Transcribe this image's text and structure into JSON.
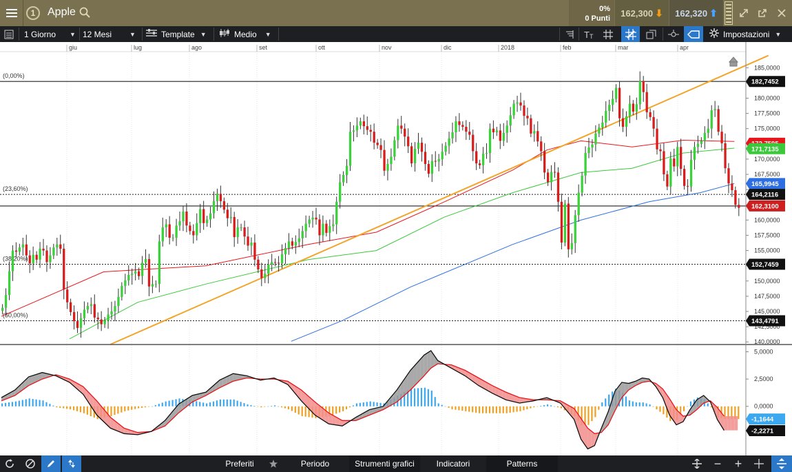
{
  "header": {
    "title": "Apple",
    "change_pct": "0%",
    "change_points": "0 Punti",
    "sell_price": "162,300",
    "buy_price": "162,320",
    "colors": {
      "bar": "#7a7150",
      "sell_arrow": "#f39c12",
      "buy_arrow": "#4aa3ff"
    }
  },
  "toolbar": {
    "interval": "1 Giorno",
    "range": "12 Mesi",
    "template": "Template",
    "style": "Medio",
    "settings": "Impostazioni",
    "icons": [
      "list-icon",
      "bar-icon",
      "text-tool-icon",
      "grid-icon",
      "crosshair-grid-icon",
      "copy-icon",
      "magnet-icon",
      "shape-icon",
      "settings-gear-icon"
    ]
  },
  "chart_data": [
    {
      "type": "candlestick",
      "instrument": "Apple",
      "x_labels": [
        "giu",
        "lug",
        "ago",
        "set",
        "ott",
        "nov",
        "dic",
        "2018",
        "feb",
        "mar",
        "apr"
      ],
      "y_ticks": [
        "185,0000",
        "182,5000",
        "180,0000",
        "177,5000",
        "175,0000",
        "172,5000",
        "170,0000",
        "167,5000",
        "165,0000",
        "162,5000",
        "160,0000",
        "157,5000",
        "155,0000",
        "152,5000",
        "150,0000",
        "147,5000",
        "145,0000",
        "142,5000",
        "140,0000"
      ],
      "ylim": [
        139.8,
        186.5
      ],
      "fib_levels": [
        {
          "label": "(0,00%)",
          "value": 182.7452,
          "tag": "182,7452"
        },
        {
          "label": "(23,60%)",
          "value": 164.2116,
          "tag": "164,2116"
        },
        {
          "label": "(38,20%)",
          "value": 152.7459,
          "tag": "152,7459"
        },
        {
          "label": "(50,00%)",
          "value": 143.4791,
          "tag": "143,4791"
        }
      ],
      "price_line": {
        "value": 162.31,
        "tag": "162,3100",
        "color": "#cc1f1f"
      },
      "ma_tags": [
        {
          "value": 172.6,
          "tag": "172,7595",
          "color": "#e8161b"
        },
        {
          "value": 171.71,
          "tag": "171,7135",
          "color": "#3bc93b"
        },
        {
          "value": 165.99,
          "tag": "165,9945",
          "color": "#2d6fe0"
        }
      ],
      "close": [
        145.6,
        147.7,
        151.6,
        155.0,
        154.8,
        155.5,
        156.0,
        154.2,
        152.9,
        154.3,
        153.5,
        155.3,
        155.0,
        153.1,
        154.2,
        155.5,
        156.0,
        155.3,
        148.6,
        146.5,
        144.9,
        143.4,
        142.3,
        143.9,
        145.3,
        145.9,
        146.2,
        144.0,
        143.7,
        142.9,
        143.5,
        144.5,
        145.0,
        145.9,
        147.4,
        149.2,
        150.1,
        151.0,
        151.2,
        151.6,
        150.8,
        153.0,
        153.6,
        149.1,
        149.5,
        149.5,
        156.5,
        158.8,
        159.3,
        157.1,
        157.1,
        159.1,
        159.8,
        161.4,
        159.1,
        158.2,
        157.5,
        159.5,
        161.8,
        159.5,
        160.1,
        161.1,
        163.1,
        164.3,
        163.1,
        161.7,
        160.3,
        160.5,
        157.2,
        158.8,
        158.8,
        157.3,
        155.8,
        156.3,
        153.5,
        151.9,
        150.5,
        151.2,
        152.7,
        153.1,
        153.0,
        152.9,
        154.4,
        155.4,
        156.5,
        155.8,
        156.4,
        157.0,
        158.2,
        159.4,
        160.1,
        160.4,
        160.1,
        157.5,
        159.4,
        157.9,
        159.0,
        159.3,
        163.0,
        166.2,
        167.4,
        168.9,
        174.5,
        174.7,
        175.5,
        176.2,
        175.4,
        174.8,
        174.5,
        172.7,
        172.3,
        171.5,
        168.1,
        169.2,
        170.4,
        173.1,
        175.5,
        175.0,
        173.7,
        172.1,
        169.3,
        171.7,
        172.7,
        171.2,
        169.2,
        167.6,
        169.7,
        169.6,
        170.0,
        171.2,
        172.2,
        173.4,
        174.4,
        176.2,
        175.6,
        175.3,
        174.5,
        174.0,
        171.3,
        169.3,
        169.0,
        170.9,
        171.0,
        175.0,
        174.4,
        174.7,
        173.0,
        174.3,
        175.5,
        177.2,
        179.1,
        179.3,
        178.8,
        177.1,
        176.7,
        174.2,
        174.6,
        172.9,
        171.3,
        167.8,
        166.2,
        167.9,
        167.8,
        163.0,
        156.3,
        162.7,
        155.2,
        156.2,
        160.8,
        164.5,
        167.3,
        171.0,
        171.9,
        172.4,
        174.2,
        175.2,
        176.0,
        177.9,
        178.9,
        179.9,
        181.7,
        176.7,
        175.3,
        177.0,
        179.1,
        177.8,
        179.0,
        182.8,
        181.0,
        177.7,
        176.9,
        175.0,
        171.6,
        171.3,
        167.5,
        165.5,
        170.1,
        168.8,
        172.0,
        168.4,
        165.6,
        165.5,
        169.9,
        172.0,
        172.5,
        173.0,
        174.3,
        175.0,
        178.0,
        178.2,
        174.5,
        172.6,
        168.5,
        166.0,
        164.9,
        162.5,
        162.0
      ],
      "moving_averages": [
        {
          "name": "MA20",
          "color": "#e8161b",
          "points": [
            [
              0,
              144.2
            ],
            [
              30,
              151.5
            ],
            [
              60,
              152.5
            ],
            [
              90,
              156.0
            ],
            [
              110,
              158.0
            ],
            [
              130,
              163.0
            ],
            [
              150,
              168.2
            ],
            [
              160,
              171.5
            ],
            [
              170,
              173.0
            ],
            [
              185,
              172.0
            ],
            [
              200,
              173.1
            ],
            [
              215,
              172.9
            ]
          ]
        },
        {
          "name": "MA50",
          "color": "#3bc93b",
          "points": [
            [
              20,
              140.5
            ],
            [
              40,
              146.5
            ],
            [
              60,
              149.5
            ],
            [
              90,
              153.5
            ],
            [
              110,
              155.0
            ],
            [
              130,
              160.5
            ],
            [
              150,
              164.5
            ],
            [
              170,
              167.8
            ],
            [
              185,
              168.5
            ],
            [
              200,
              171.0
            ],
            [
              215,
              171.8
            ]
          ]
        },
        {
          "name": "MA200",
          "color": "#2d6fe0",
          "points": [
            [
              85,
              140.1
            ],
            [
              100,
              143.5
            ],
            [
              120,
              149.0
            ],
            [
              150,
              156.0
            ],
            [
              170,
              160.0
            ],
            [
              190,
              163.0
            ],
            [
              205,
              164.5
            ],
            [
              215,
              166.0
            ]
          ]
        }
      ],
      "trendline": {
        "color": "#f2a52a",
        "from": [
          32,
          139.6
        ],
        "to": [
          225,
          187.0
        ]
      }
    },
    {
      "type": "macd",
      "y_ticks": [
        "5,0000",
        "2,5000",
        "0,0000"
      ],
      "ylim": [
        -4.5,
        5.6
      ],
      "value_tags": [
        {
          "value": -1.1644,
          "tag": "-1,1644",
          "color": "#3ba8ef"
        },
        {
          "value": -2.2271,
          "tag": "-2,2271",
          "color": "#111111"
        }
      ],
      "macd_line": [
        [
          0,
          0.8
        ],
        [
          4,
          1.5
        ],
        [
          8,
          2.7
        ],
        [
          12,
          3.1
        ],
        [
          16,
          2.8
        ],
        [
          20,
          2.2
        ],
        [
          24,
          1.1
        ],
        [
          28,
          -0.8
        ],
        [
          32,
          -2.0
        ],
        [
          36,
          -2.5
        ],
        [
          40,
          -2.6
        ],
        [
          44,
          -2.3
        ],
        [
          48,
          -1.3
        ],
        [
          52,
          0.2
        ],
        [
          56,
          1.0
        ],
        [
          60,
          1.3
        ],
        [
          64,
          2.4
        ],
        [
          68,
          3.0
        ],
        [
          72,
          2.8
        ],
        [
          76,
          2.4
        ],
        [
          80,
          2.6
        ],
        [
          84,
          2.0
        ],
        [
          88,
          0.5
        ],
        [
          92,
          -0.8
        ],
        [
          96,
          -1.6
        ],
        [
          100,
          -1.8
        ],
        [
          104,
          -1.0
        ],
        [
          108,
          -0.3
        ],
        [
          112,
          0.0
        ],
        [
          116,
          1.5
        ],
        [
          120,
          3.3
        ],
        [
          124,
          4.7
        ],
        [
          126,
          5.1
        ],
        [
          128,
          4.2
        ],
        [
          132,
          3.5
        ],
        [
          136,
          2.8
        ],
        [
          140,
          1.9
        ],
        [
          144,
          1.2
        ],
        [
          148,
          0.6
        ],
        [
          152,
          0.3
        ],
        [
          156,
          0.5
        ],
        [
          160,
          0.8
        ],
        [
          164,
          0.3
        ],
        [
          168,
          -1.2
        ],
        [
          170,
          -3.0
        ],
        [
          172,
          -3.9
        ],
        [
          174,
          -3.6
        ],
        [
          176,
          -2.0
        ],
        [
          178,
          -0.5
        ],
        [
          180,
          1.4
        ],
        [
          182,
          2.2
        ],
        [
          184,
          2.1
        ],
        [
          186,
          2.3
        ],
        [
          188,
          2.6
        ],
        [
          190,
          2.5
        ],
        [
          192,
          1.8
        ],
        [
          194,
          0.8
        ],
        [
          196,
          -0.8
        ],
        [
          198,
          -1.7
        ],
        [
          200,
          -1.4
        ],
        [
          202,
          -0.3
        ],
        [
          204,
          0.6
        ],
        [
          206,
          1.0
        ],
        [
          208,
          0.4
        ],
        [
          210,
          -1.2
        ],
        [
          212,
          -2.2
        ]
      ],
      "signal_line": [
        [
          0,
          0.5
        ],
        [
          4,
          1.0
        ],
        [
          8,
          1.9
        ],
        [
          12,
          2.5
        ],
        [
          16,
          2.9
        ],
        [
          20,
          2.5
        ],
        [
          24,
          1.8
        ],
        [
          28,
          0.5
        ],
        [
          32,
          -1.0
        ],
        [
          36,
          -2.0
        ],
        [
          40,
          -2.4
        ],
        [
          44,
          -2.3
        ],
        [
          48,
          -1.8
        ],
        [
          52,
          -0.6
        ],
        [
          56,
          0.4
        ],
        [
          60,
          1.0
        ],
        [
          64,
          1.7
        ],
        [
          68,
          2.3
        ],
        [
          72,
          2.6
        ],
        [
          76,
          2.5
        ],
        [
          80,
          2.5
        ],
        [
          84,
          2.3
        ],
        [
          88,
          1.5
        ],
        [
          92,
          0.4
        ],
        [
          96,
          -0.6
        ],
        [
          100,
          -1.3
        ],
        [
          104,
          -1.3
        ],
        [
          108,
          -0.8
        ],
        [
          112,
          -0.3
        ],
        [
          116,
          0.4
        ],
        [
          120,
          1.5
        ],
        [
          124,
          2.8
        ],
        [
          126,
          3.5
        ],
        [
          128,
          3.9
        ],
        [
          132,
          3.8
        ],
        [
          136,
          3.3
        ],
        [
          140,
          2.6
        ],
        [
          144,
          1.9
        ],
        [
          148,
          1.3
        ],
        [
          152,
          0.8
        ],
        [
          156,
          0.6
        ],
        [
          160,
          0.6
        ],
        [
          164,
          0.5
        ],
        [
          168,
          -0.2
        ],
        [
          170,
          -1.1
        ],
        [
          172,
          -2.0
        ],
        [
          174,
          -2.5
        ],
        [
          176,
          -2.4
        ],
        [
          178,
          -1.7
        ],
        [
          180,
          -0.4
        ],
        [
          182,
          0.8
        ],
        [
          184,
          1.5
        ],
        [
          186,
          1.9
        ],
        [
          188,
          2.2
        ],
        [
          190,
          2.3
        ],
        [
          192,
          2.1
        ],
        [
          194,
          1.6
        ],
        [
          196,
          0.7
        ],
        [
          198,
          -0.3
        ],
        [
          200,
          -0.9
        ],
        [
          202,
          -0.8
        ],
        [
          204,
          -0.3
        ],
        [
          206,
          0.3
        ],
        [
          208,
          0.5
        ],
        [
          210,
          -0.1
        ],
        [
          212,
          -0.9
        ]
      ],
      "histogram_colors": {
        "positive": "#3ba8ef",
        "negative": "#f0a020"
      }
    }
  ],
  "bottombar": {
    "favorites": "Preferiti",
    "period": "Periodo",
    "tools": "Strumenti grafici",
    "indicators": "Indicatori",
    "patterns": "Patterns"
  }
}
